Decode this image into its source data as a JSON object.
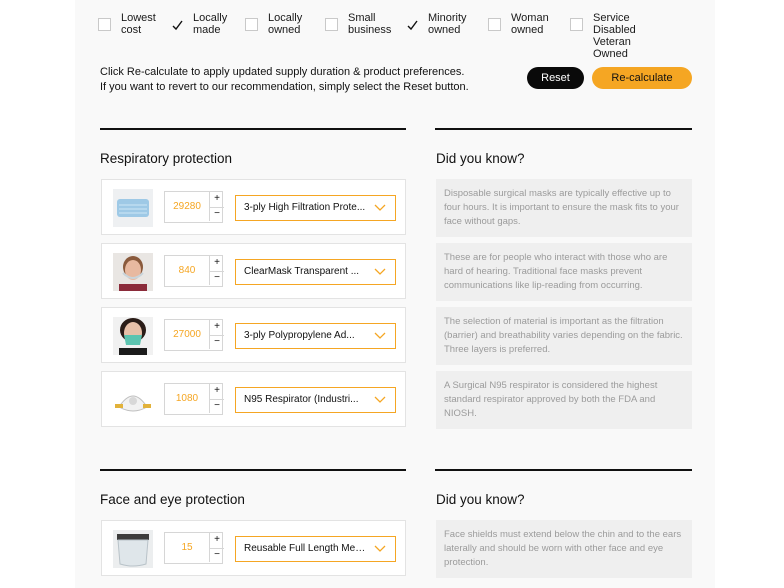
{
  "filters": [
    {
      "label": "Lowest\ncost",
      "checked": false
    },
    {
      "label": "Locally\nmade",
      "checked": true
    },
    {
      "label": "Locally\nowned",
      "checked": false
    },
    {
      "label": "Small\nbusiness",
      "checked": false
    },
    {
      "label": "Minority\nowned",
      "checked": true
    },
    {
      "label": "Woman\nowned",
      "checked": false
    },
    {
      "label": "Service Disabled\nVeteran Owned",
      "checked": false
    }
  ],
  "info": {
    "line1": "Click Re-calculate to apply updated supply duration & product preferences.",
    "line2": "If you want to revert to our recommendation, simply select the Reset button."
  },
  "buttons": {
    "reset": "Reset",
    "recalculate": "Re-calculate"
  },
  "colors": {
    "accent": "#f5a623",
    "dark": "#0a0a0a"
  },
  "sections": [
    {
      "title": "Respiratory protection",
      "tip_title": "Did you know?",
      "products": [
        {
          "image": "surgical-mask",
          "qty": "29280",
          "plus": "+",
          "minus": "−",
          "select": "3-ply High Filtration Prote..."
        },
        {
          "image": "clear-mask",
          "qty": "840",
          "plus": "+",
          "minus": "−",
          "select": "ClearMask Transparent ..."
        },
        {
          "image": "polypropylene-mask",
          "qty": "27000",
          "plus": "+",
          "minus": "−",
          "select": "3-ply Polypropylene Ad..."
        },
        {
          "image": "n95-respirator",
          "qty": "1080",
          "plus": "+",
          "minus": "−",
          "select": "N95 Respirator (Industri..."
        }
      ],
      "tips": [
        "Disposable surgical masks are typically effective up to four hours. It is important to ensure the mask fits to your face without gaps.",
        "These are for people who interact with those who are hard of hearing. Traditional face masks prevent communications like lip-reading from occurring.",
        "The selection of material is important as the filtration (barrier) and breathability varies depending on the fabric. Three layers is preferred.",
        "A Surgical N95 respirator is considered the highest standard respirator approved by both the FDA and NIOSH."
      ]
    },
    {
      "title": "Face and eye protection",
      "tip_title": "Did you know?",
      "products": [
        {
          "image": "face-shield",
          "qty": "15",
          "plus": "+",
          "minus": "−",
          "select": "Reusable Full Length Med..."
        }
      ],
      "tips": [
        "Face shields must extend below the chin and to the ears laterally and should be worn with other face and eye protection."
      ]
    }
  ]
}
